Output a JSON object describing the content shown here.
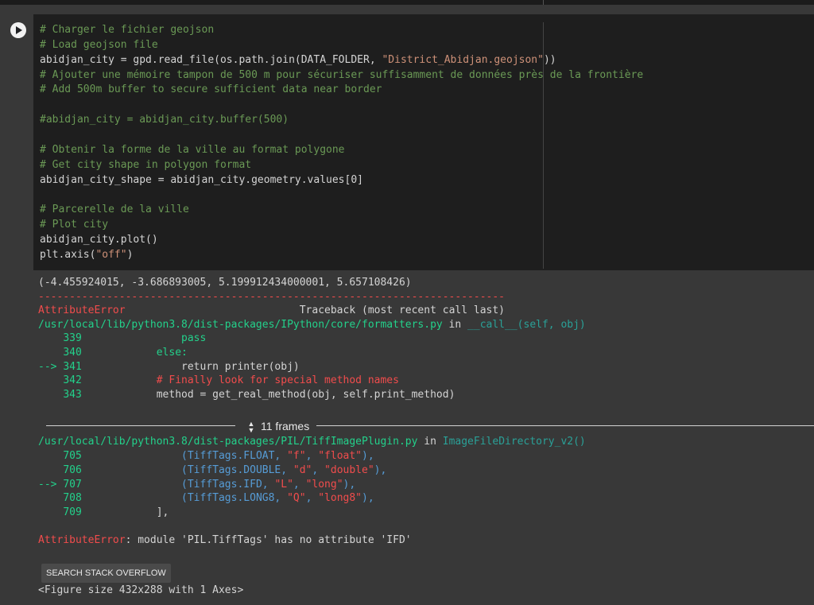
{
  "code_lines": [
    {
      "segments": [
        {
          "t": "# Charger le fichier geojson",
          "k": "comment"
        }
      ]
    },
    {
      "segments": [
        {
          "t": "# Load geojson file",
          "k": "comment"
        }
      ]
    },
    {
      "segments": [
        {
          "t": "abidjan_city = gpd.read_file(os.path.join(DATA_FOLDER, ",
          "k": "code"
        },
        {
          "t": "\"District_Abidjan.geojson\"",
          "k": "str"
        },
        {
          "t": "))",
          "k": "code"
        }
      ]
    },
    {
      "segments": [
        {
          "t": "# Ajouter une mémoire tampon de 500 m pour sécuriser suffisamment de données près de la frontière",
          "k": "comment"
        }
      ]
    },
    {
      "segments": [
        {
          "t": "# Add 500m buffer to secure sufficient data near border",
          "k": "comment"
        }
      ]
    },
    {
      "segments": [
        {
          "t": "",
          "k": "code"
        }
      ]
    },
    {
      "segments": [
        {
          "t": "#abidjan_city = abidjan_city.buffer(500)",
          "k": "comment"
        }
      ]
    },
    {
      "segments": [
        {
          "t": "",
          "k": "code"
        }
      ]
    },
    {
      "segments": [
        {
          "t": "# Obtenir la forme de la ville au format polygone",
          "k": "comment"
        }
      ]
    },
    {
      "segments": [
        {
          "t": "# Get city shape in polygon format",
          "k": "comment"
        }
      ]
    },
    {
      "segments": [
        {
          "t": "abidjan_city_shape = abidjan_city.geometry.values[0]",
          "k": "code"
        }
      ]
    },
    {
      "segments": [
        {
          "t": "",
          "k": "code"
        }
      ]
    },
    {
      "segments": [
        {
          "t": "# Parcerelle de la ville",
          "k": "comment"
        }
      ]
    },
    {
      "segments": [
        {
          "t": "# Plot city",
          "k": "comment"
        }
      ]
    },
    {
      "segments": [
        {
          "t": "abidjan_city.plot()",
          "k": "code"
        }
      ]
    },
    {
      "segments": [
        {
          "t": "plt.axis(",
          "k": "code"
        },
        {
          "t": "\"off\"",
          "k": "str"
        },
        {
          "t": ")",
          "k": "code"
        }
      ]
    }
  ],
  "output": {
    "result_line": "(-4.455924015, -3.686893005, 5.199912434000001, 5.657108426)",
    "dash_line": "---------------------------------------------------------------------------",
    "error_name": "AttributeError",
    "traceback_header": "                            Traceback (most recent call last)",
    "frame1_path": "/usr/local/lib/python3.8/dist-packages/IPython/core/formatters.py",
    "frame1_in": " in ",
    "frame1_func": "__call__(self, obj)",
    "frame1_lines": [
      {
        "arrow": "    ",
        "num": "339",
        "code": "                pass",
        "style": "green"
      },
      {
        "arrow": "    ",
        "num": "340",
        "code": "            else:",
        "style": "green"
      },
      {
        "arrow": "--> ",
        "num": "341",
        "code": "                return printer(obj)",
        "style": "mixed1"
      },
      {
        "arrow": "    ",
        "num": "342",
        "code": "            # Finally look for special method names",
        "style": "red"
      },
      {
        "arrow": "    ",
        "num": "343",
        "code": "            method = get_real_method(obj, self.print_method)",
        "style": "plain"
      }
    ],
    "frames_toggle_label": "11 frames",
    "frame2_path": "/usr/local/lib/python3.8/dist-packages/PIL/TiffImagePlugin.py",
    "frame2_in": " in ",
    "frame2_func": "ImageFileDirectory_v2()",
    "frame2_lines": [
      {
        "arrow": "    ",
        "num": "705",
        "pre": "                (TiffTags.FLOAT, ",
        "s1": "\"f\"",
        "mid": ", ",
        "s2": "\"float\"",
        "post": "),"
      },
      {
        "arrow": "    ",
        "num": "706",
        "pre": "                (TiffTags.DOUBLE, ",
        "s1": "\"d\"",
        "mid": ", ",
        "s2": "\"double\"",
        "post": "),"
      },
      {
        "arrow": "--> ",
        "num": "707",
        "pre": "                (TiffTags.IFD, ",
        "s1": "\"L\"",
        "mid": ", ",
        "s2": "\"long\"",
        "post": "),"
      },
      {
        "arrow": "    ",
        "num": "708",
        "pre": "                (TiffTags.LONG8, ",
        "s1": "\"Q\"",
        "mid": ", ",
        "s2": "\"long8\"",
        "post": "),"
      },
      {
        "arrow": "    ",
        "num": "709",
        "pre": "            ],",
        "s1": "",
        "mid": "",
        "s2": "",
        "post": ""
      }
    ],
    "final_error_name": "AttributeError",
    "final_error_msg": ": module 'PIL.TiffTags' has no attribute 'IFD'",
    "search_button": "SEARCH STACK OVERFLOW",
    "figure_line": "<Figure size 432x288 with 1 Axes>"
  },
  "colors": {
    "editor_bg": "#1e1e1e",
    "output_bg": "#383838",
    "comment": "#6a9955",
    "string": "#ce9178",
    "error": "#f14c4c",
    "traceback_green": "#23d18b"
  }
}
